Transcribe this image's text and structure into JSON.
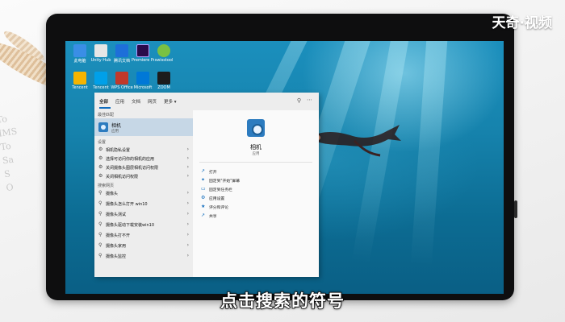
{
  "watermark": "天奇·视频",
  "subtitle": "点击搜索的符号",
  "decor_note": "8\nTo\nIMS\nTo\nSa\nS\nO",
  "desktop_icons": [
    {
      "label": "此电脑",
      "color": "#3a8ee6"
    },
    {
      "label": "Unity Hub",
      "color": "#e6e6e6"
    },
    {
      "label": "腾讯文档",
      "color": "#1e6fd9"
    },
    {
      "label": "Premiere Pro",
      "color": "#2a0a4a"
    },
    {
      "label": "swisstool",
      "color": "#7ac143"
    },
    {
      "label": "Tencent",
      "color": "#f5b400"
    },
    {
      "label": "Tencent",
      "color": "#00a0e9"
    },
    {
      "label": "WPS Office",
      "color": "#c0392b"
    },
    {
      "label": "Microsoft",
      "color": "#0078d7"
    },
    {
      "label": "ZOOM",
      "color": "#1c1c1c"
    }
  ],
  "search_panel": {
    "tabs": [
      "全部",
      "应用",
      "文档",
      "网页",
      "更多 ▾"
    ],
    "tab_icon": "⚲",
    "more_icon": "⋯",
    "best_match_heading": "最佳匹配",
    "best_match": {
      "name": "相机",
      "type": "应用"
    },
    "settings_heading": "设置",
    "settings_items": [
      "相机隐私设置",
      "选择可访问你的相机的应用",
      "关闭摄像头图层相机访问权限",
      "关闭相机访问权限"
    ],
    "web_heading": "搜索网页",
    "web_items": [
      "摄像头",
      "摄像头怎么打开 win10",
      "摄像头测试",
      "摄像头驱动下载安装win10",
      "摄像头打不开",
      "摄像头家用",
      "摄像头监控"
    ],
    "detail": {
      "app_name": "相机",
      "app_type": "应用",
      "actions": [
        {
          "icon": "↗",
          "label": "打开"
        },
        {
          "icon": "✦",
          "label": "固定到\"开始\"屏幕"
        },
        {
          "icon": "▭",
          "label": "固定到任务栏"
        },
        {
          "icon": "⚙",
          "label": "应用设置"
        },
        {
          "icon": "★",
          "label": "评分和评论"
        },
        {
          "icon": "↗",
          "label": "共享"
        }
      ]
    }
  }
}
